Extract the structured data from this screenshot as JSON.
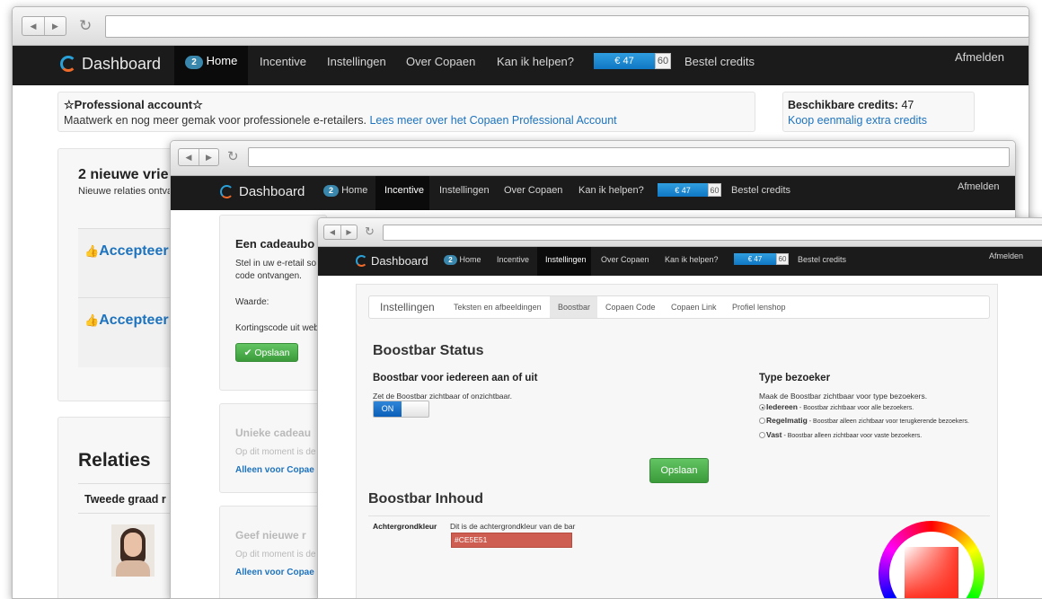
{
  "common": {
    "brand": "Dashboard",
    "badge": "2",
    "nav": {
      "home": "Home",
      "incentive": "Incentive",
      "settings": "Instellingen",
      "about": "Over Copaen",
      "help": "Kan ik helpen?"
    },
    "credit_amount": "€ 47",
    "credit_total": "60",
    "order": "Bestel credits",
    "logout": "Afmelden"
  },
  "back": {
    "pro_title": "☆Professional account☆",
    "pro_text": "Maatwerk en nog meer gemak voor professionele e-retailers.",
    "pro_link": "Lees meer over het Copaen Professional Account",
    "credits_label": "Beschikbare credits:",
    "credits_value": "47",
    "credits_link": "Koop eenmalig extra credits",
    "friends_title": "2 nieuwe vrie",
    "friends_sub": "Nieuwe relaties ontva",
    "accept1": "Accepteer",
    "accept2": "Accepteer",
    "relations_title": "Relaties",
    "second_degree": "Tweede graad r"
  },
  "mid": {
    "card_title": "Een cadeaubo",
    "card_text1": "Stel in uw e-retail so",
    "card_text2": "code ontvangen.",
    "waarde": "Waarde:",
    "kortingscode": "Kortingscode uit web",
    "save": "Opslaan",
    "unique_title": "Unieke cadeau",
    "unique_text": "Op dit moment is de",
    "unique_link": "Alleen voor Copae",
    "give_title": "Geef nieuwe r",
    "give_text": "Op dit moment is de",
    "give_link": "Alleen voor Copae"
  },
  "front": {
    "tabs": {
      "title": "Instellingen",
      "t1": "Teksten en afbeeldingen",
      "t2": "Boostbar",
      "t3": "Copaen Code",
      "t4": "Copaen Link",
      "t5": "Profiel lenshop"
    },
    "status_title": "Boostbar Status",
    "toggle_label": "Boostbar voor iedereen aan of uit",
    "toggle_help": "Zet de Boostbar zichtbaar of onzichtbaar.",
    "toggle_on": "ON",
    "type_title": "Type bezoeker",
    "type_help": "Maak de Boostbar zichtbaar voor type bezoekers.",
    "opt1_name": "Iedereen",
    "opt1_desc": " - Boostbar zichtbaar voor alle bezoekers.",
    "opt2_name": "Regelmatig",
    "opt2_desc": " - Boostbar alleen zichtbaar voor terugkerende bezoekers.",
    "opt3_name": "Vast",
    "opt3_desc": " - Boostbar alleen zichtbaar voor vaste bezoekers.",
    "save": "Opslaan",
    "content_title": "Boostbar Inhoud",
    "bg_label": "Achtergrondkleur",
    "bg_help": "Dit is de achtergrondkleur van de bar",
    "bg_value": "#CE5E51"
  },
  "colors": {
    "accent": "#CE5E51",
    "nav_bg": "#1b1b1b",
    "link": "#1e73be",
    "green": "#4cae4c"
  }
}
